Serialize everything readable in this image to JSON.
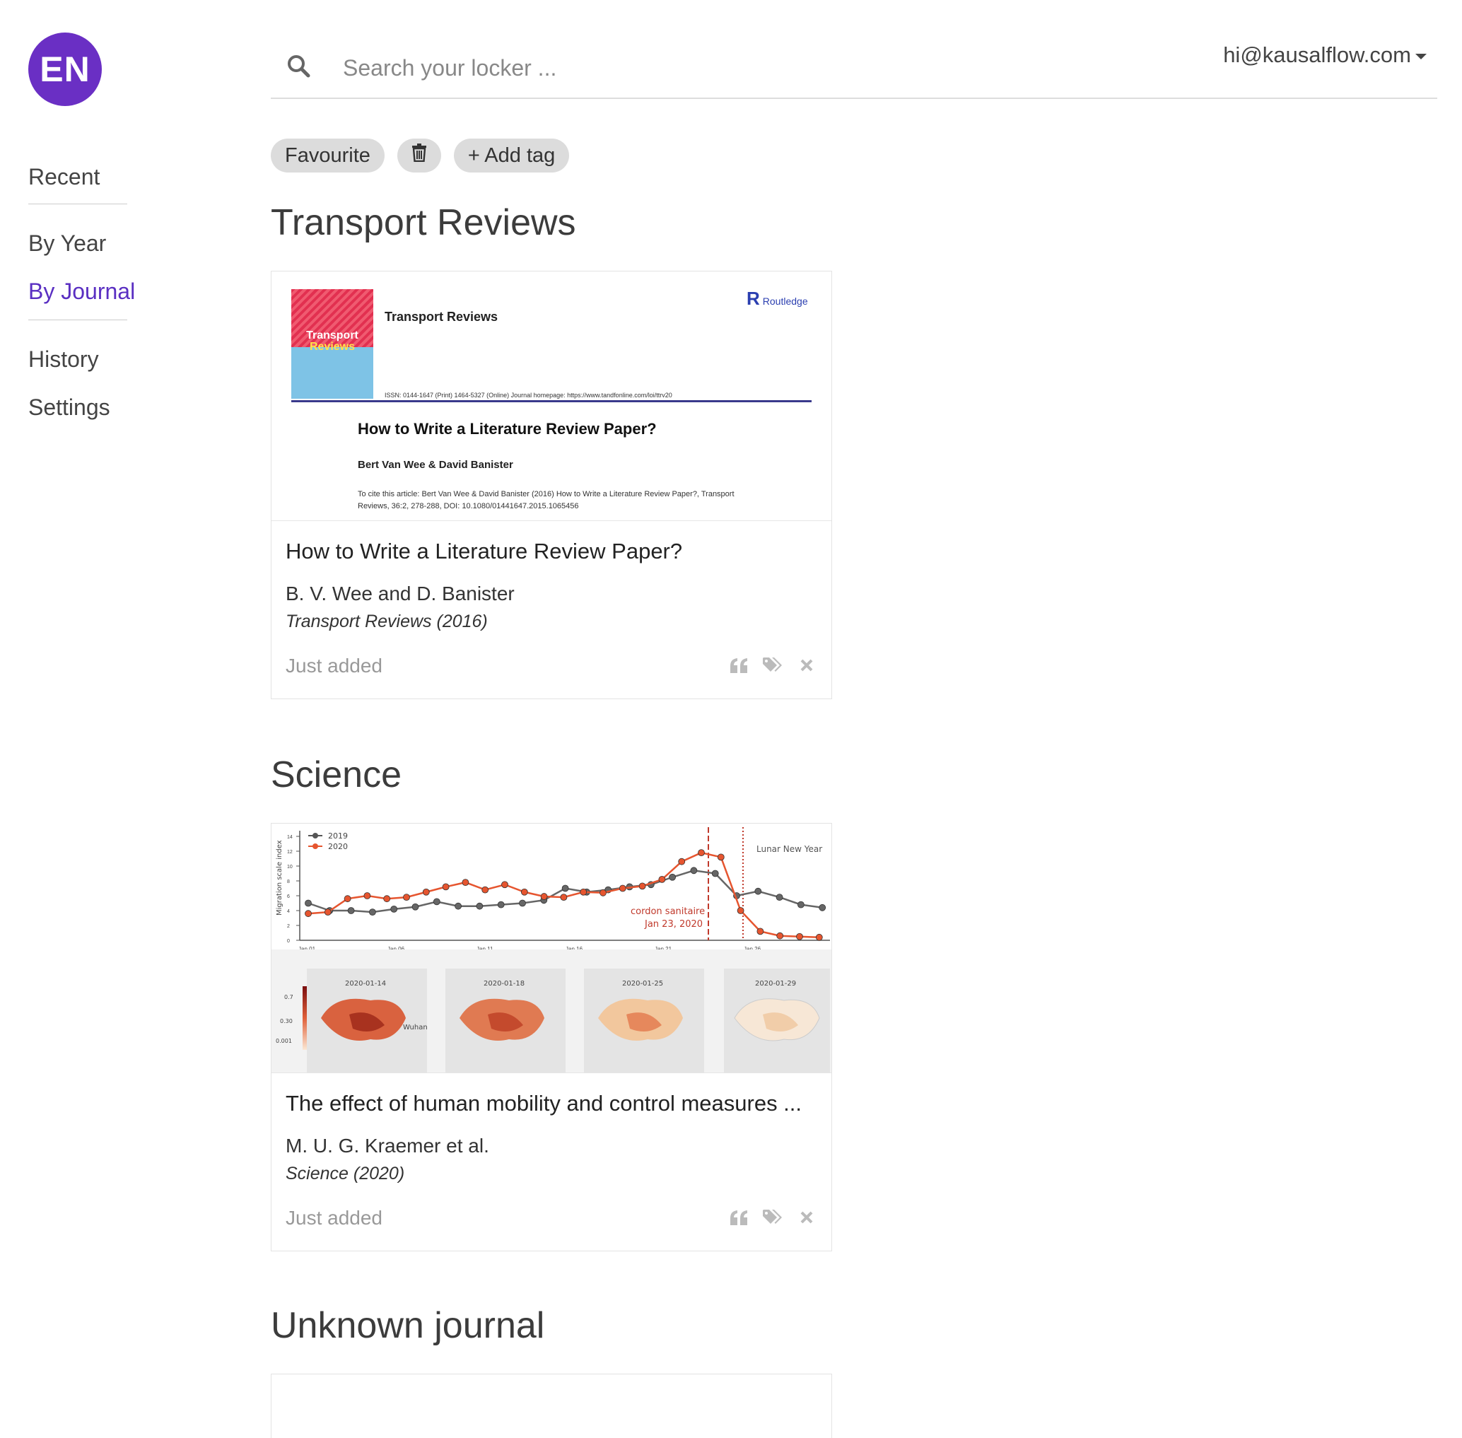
{
  "avatar": {
    "initials": "EN"
  },
  "nav": {
    "recent": "Recent",
    "by_year": "By Year",
    "by_journal": "By Journal",
    "history": "History",
    "settings": "Settings"
  },
  "search": {
    "placeholder": "Search your locker ..."
  },
  "user": {
    "email": "hi@kausalflow.com"
  },
  "tags": {
    "favourite": "Favourite",
    "add_tag": "+ Add tag"
  },
  "colors": {
    "accent": "#5a2fc2",
    "avatar_bg": "#6a2fc4",
    "pill_bg": "#dcdcdc",
    "muted": "#999999"
  },
  "sections": [
    {
      "title": "Transport Reviews",
      "card": {
        "title": "How to Write a Literature Review Paper?",
        "authors": "B. V. Wee and D. Banister",
        "journal": "Transport Reviews (2016)",
        "status": "Just added",
        "thumb": {
          "cover_title_1": "Transport",
          "cover_title_2": "Reviews",
          "journal_name": "Transport Reviews",
          "publisher": "Routledge",
          "issn": "ISSN: 0144-1647 (Print) 1464-5327 (Online) Journal homepage: https://www.tandfonline.com/loi/ttrv20",
          "paper_title": "How to Write a Literature Review Paper?",
          "paper_authors": "Bert Van Wee & David Banister",
          "cite": "To cite this article: Bert Van Wee & David Banister (2016) How to Write a Literature Review Paper?, Transport Reviews, 36:2, 278-288, DOI: 10.1080/01441647.2015.1065456"
        }
      }
    },
    {
      "title": "Science",
      "card": {
        "title": "The effect of human mobility and control measures ...",
        "authors": "M. U. G. Kraemer et al.",
        "journal": "Science (2020)",
        "status": "Just added",
        "thumb": {
          "legend_2019": "2019",
          "legend_2020": "2020",
          "ylabel": "Migration scale index",
          "annot_lunar": "Lunar New Year",
          "annot_cordon_1": "cordon sanitaire",
          "annot_cordon_2": "Jan 23, 2020",
          "xticks": [
            "Jan 01",
            "Jan 06",
            "Jan 11",
            "Jan 16",
            "Jan 21",
            "Jan 26"
          ],
          "yticks": [
            "0",
            "2",
            "4",
            "6",
            "8",
            "10",
            "12",
            "14"
          ],
          "map_dates": [
            "2020-01-14",
            "2020-01-18",
            "2020-01-25",
            "2020-01-29"
          ],
          "map_label": "Wuhan",
          "scale_labels": [
            "0.7",
            "0.30",
            "0.001"
          ]
        }
      }
    },
    {
      "title": "Unknown journal"
    }
  ]
}
